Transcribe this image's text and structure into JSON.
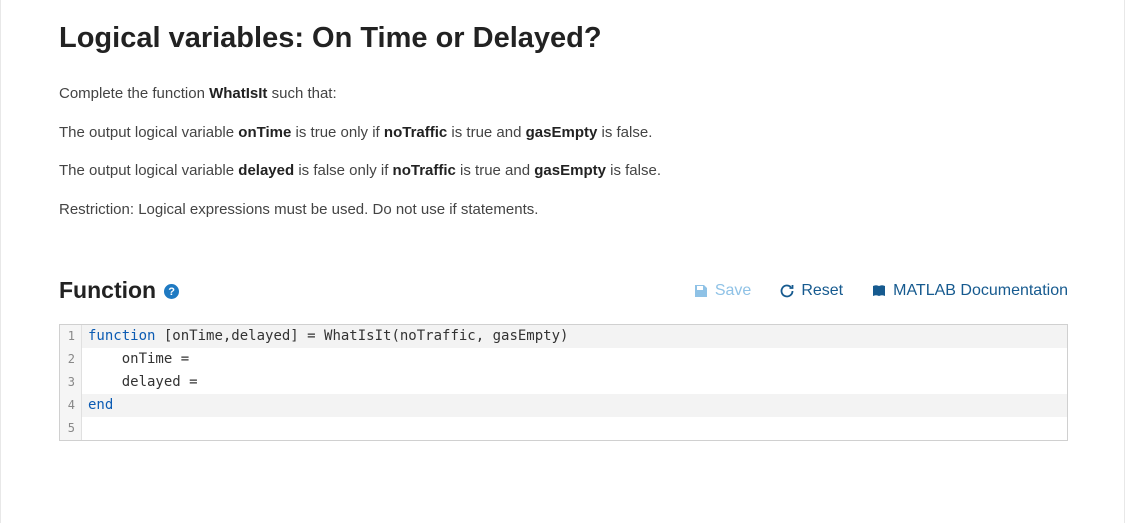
{
  "title": "Logical variables: On Time or Delayed?",
  "paragraphs": {
    "p1_a": "Complete the function ",
    "p1_b": "WhatIsIt",
    "p1_c": " such that:",
    "p2_a": "The output logical variable ",
    "p2_b": "onTime",
    "p2_c": " is true only if ",
    "p2_d": "noTraffic",
    "p2_e": " is true and ",
    "p2_f": "gasEmpty",
    "p2_g": " is false.",
    "p3_a": "The output logical variable ",
    "p3_b": "delayed",
    "p3_c": " is false only if ",
    "p3_d": "noTraffic",
    "p3_e": " is true and ",
    "p3_f": "gasEmpty",
    "p3_g": " is false.",
    "p4": "Restriction:  Logical expressions must be used.  Do not use if statements."
  },
  "section": {
    "label": "Function",
    "help": "?"
  },
  "actions": {
    "save": "Save",
    "reset": "Reset",
    "doc": "MATLAB Documentation"
  },
  "code": {
    "lines": [
      {
        "n": "1",
        "kw": "function",
        "rest": " [onTime,delayed] = WhatIsIt(noTraffic, gasEmpty)",
        "active": true
      },
      {
        "n": "2",
        "kw": "",
        "rest": "    onTime = ",
        "active": false
      },
      {
        "n": "3",
        "kw": "",
        "rest": "    delayed = ",
        "active": false
      },
      {
        "n": "4",
        "kw": "end",
        "rest": "",
        "active": true
      },
      {
        "n": "5",
        "kw": "",
        "rest": "",
        "active": false
      }
    ]
  }
}
